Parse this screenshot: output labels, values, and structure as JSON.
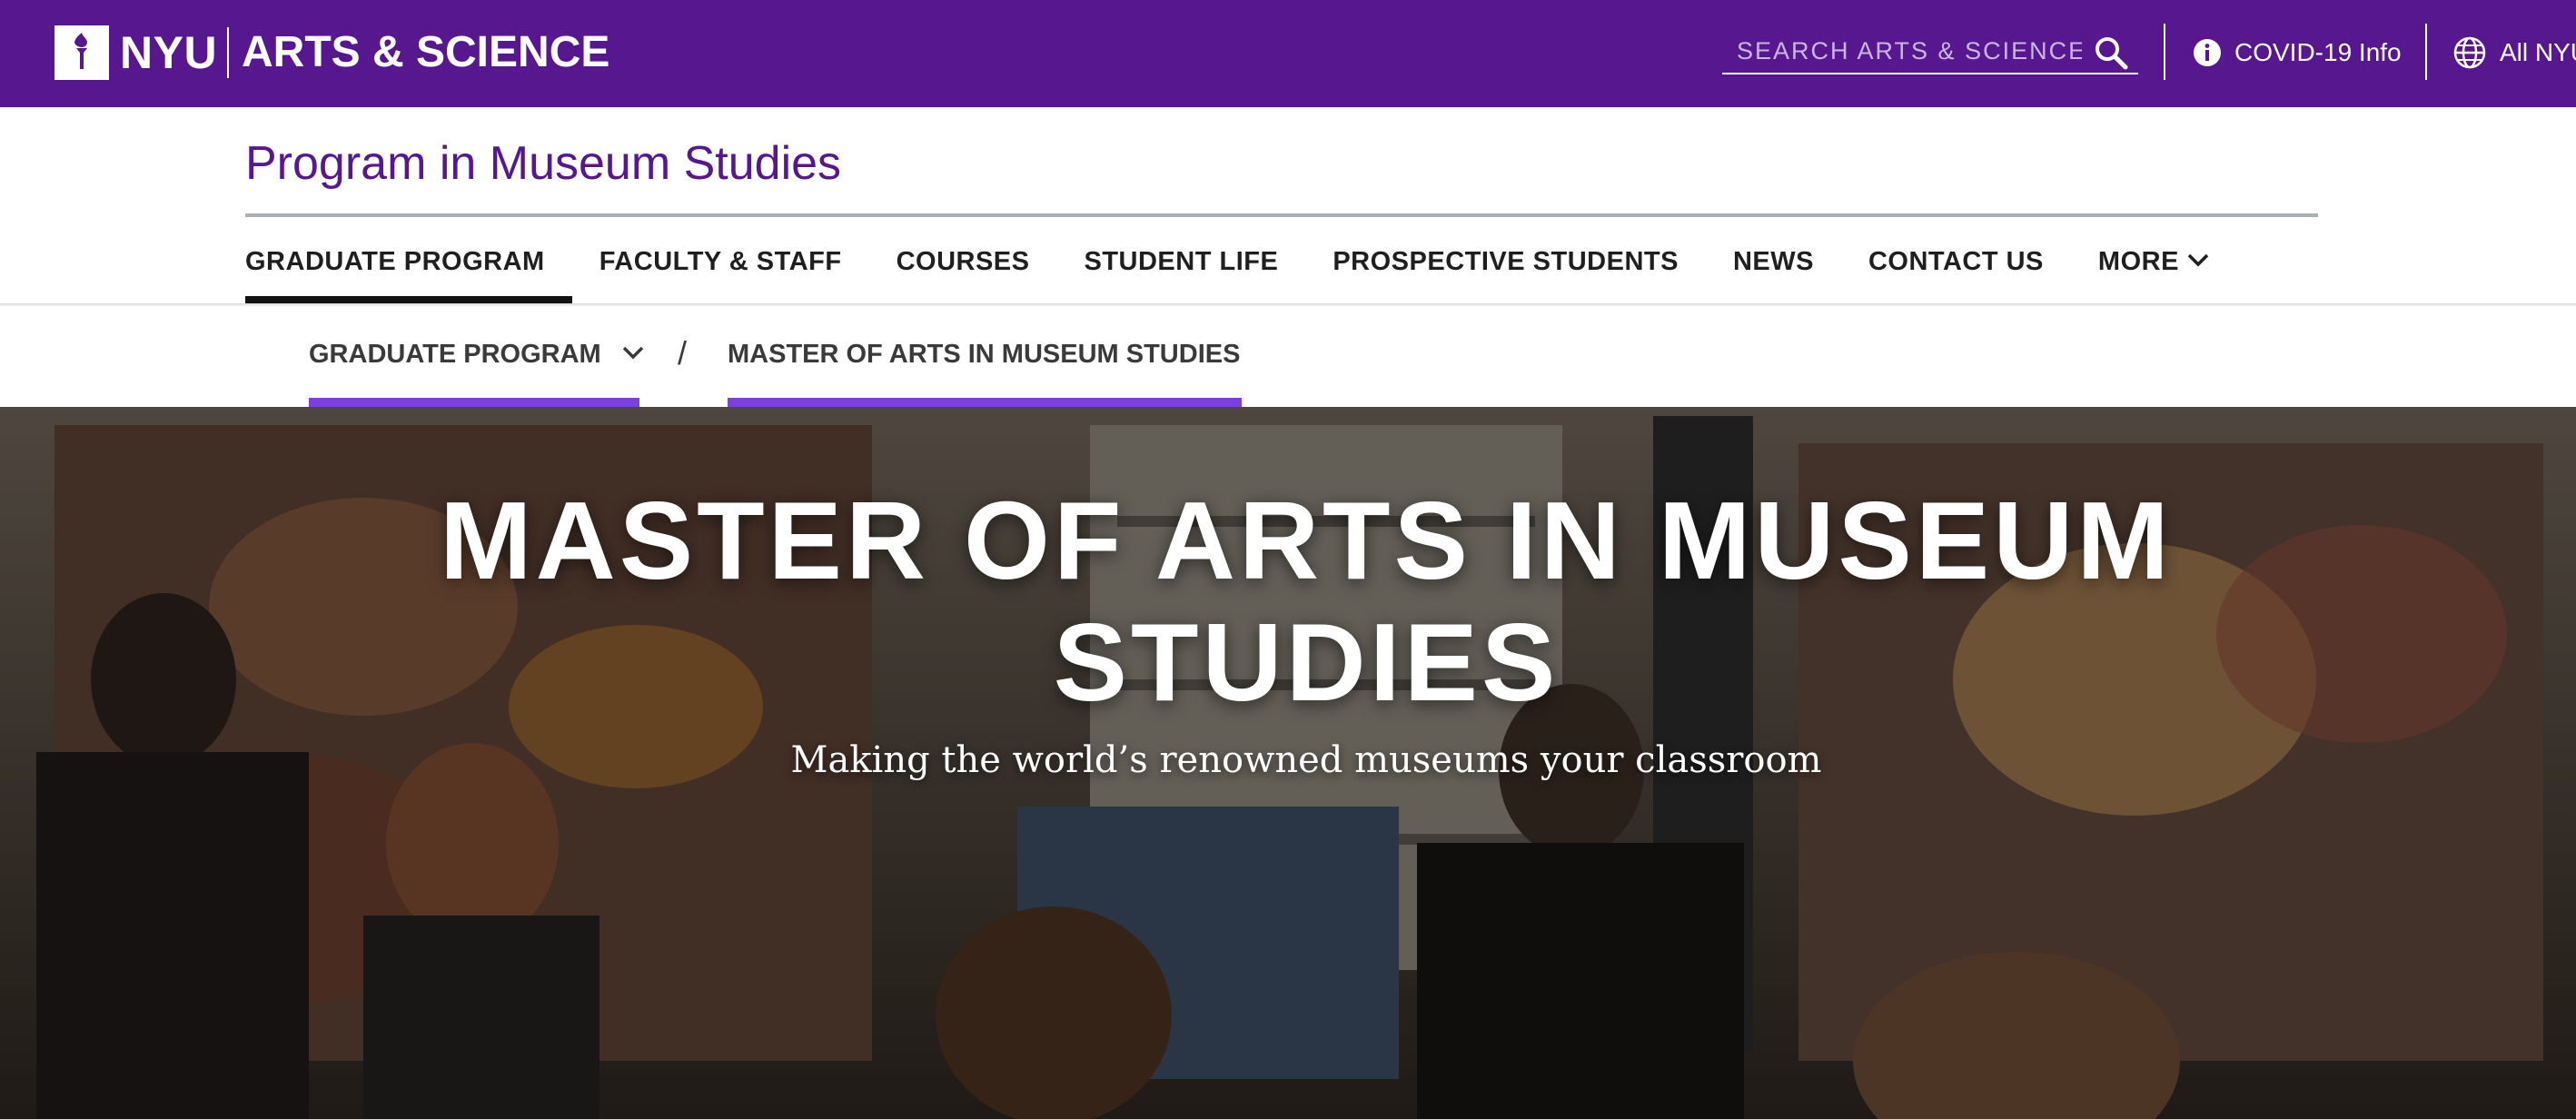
{
  "header": {
    "brand_nyu": "NYU",
    "brand_unit": "ARTS & SCIENCE",
    "search_placeholder": "SEARCH ARTS & SCIENCE",
    "covid_label": "COVID-19 Info",
    "all_nyu_label": "All NYU",
    "colors": {
      "brand_purple": "#57188f",
      "accent_purple": "#7b3fe4"
    },
    "icons": [
      "torch-logo-icon",
      "search-icon",
      "info-icon",
      "globe-icon"
    ]
  },
  "program": {
    "title": "Program in Museum Studies"
  },
  "nav": {
    "items": [
      {
        "label": "GRADUATE PROGRAM",
        "active": true
      },
      {
        "label": "FACULTY & STAFF"
      },
      {
        "label": "COURSES"
      },
      {
        "label": "STUDENT LIFE"
      },
      {
        "label": "PROSPECTIVE STUDENTS"
      },
      {
        "label": "NEWS"
      },
      {
        "label": "CONTACT US"
      },
      {
        "label": "MORE"
      }
    ]
  },
  "breadcrumb": {
    "items": [
      {
        "label": "GRADUATE PROGRAM"
      },
      {
        "label": "MASTER OF ARTS IN MUSEUM STUDIES"
      }
    ],
    "separator": "/"
  },
  "hero": {
    "title_line1": "MASTER OF ARTS IN MUSEUM",
    "title_line2": "STUDIES",
    "subtitle": "Making the world’s renowned museums your classroom"
  }
}
